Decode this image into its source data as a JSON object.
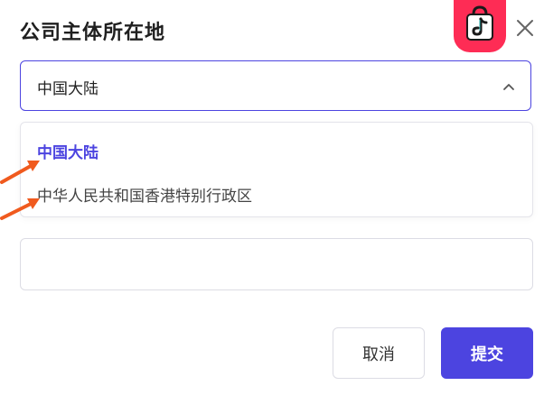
{
  "dialog": {
    "title": "公司主体所在地",
    "close_icon": "close-icon",
    "logo_icon": "tiktok-shop-logo-icon"
  },
  "select": {
    "value": "中国大陆",
    "chevron_icon": "chevron-up-icon",
    "options": [
      {
        "label": "中国大陆",
        "selected": true
      },
      {
        "label": "中华人民共和国香港特别行政区",
        "selected": false
      }
    ]
  },
  "input": {
    "value": "",
    "placeholder": ""
  },
  "actions": {
    "cancel_label": "取消",
    "submit_label": "提交"
  },
  "colors": {
    "accent": "#4c44e0",
    "brand": "#fe2c55",
    "annotation_arrow": "#f05a1e"
  }
}
